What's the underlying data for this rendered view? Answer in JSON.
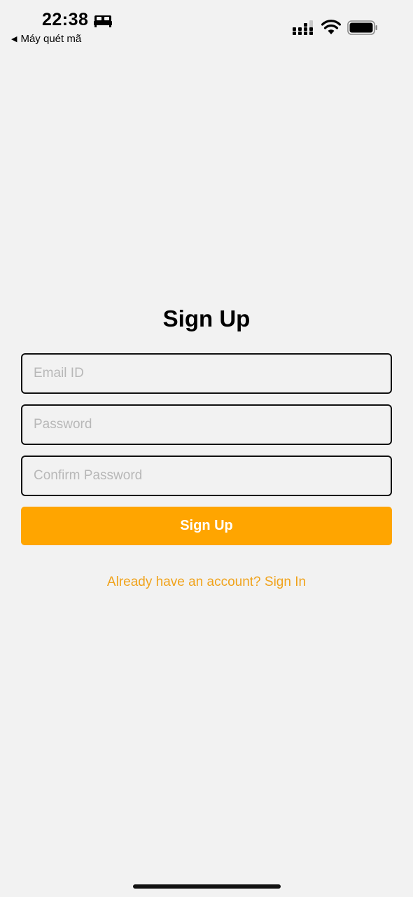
{
  "status_bar": {
    "time": "22:38",
    "back_app_label": "Máy quét mã",
    "icons": [
      "bed-icon",
      "signal-icon",
      "wifi-icon",
      "battery-icon"
    ]
  },
  "form": {
    "title": "Sign Up",
    "email_placeholder": "Email ID",
    "password_placeholder": "Password",
    "confirm_password_placeholder": "Confirm Password",
    "submit_label": "Sign Up",
    "signin_link_label": "Already have an account? Sign In"
  },
  "colors": {
    "accent": "#ffa500",
    "link": "#f0a31c",
    "background": "#f2f2f2"
  }
}
